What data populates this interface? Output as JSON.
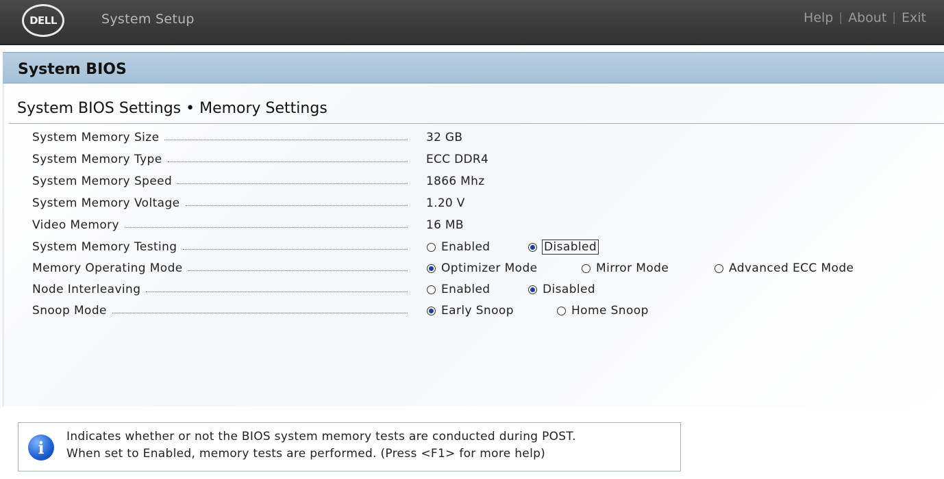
{
  "header": {
    "logo_text": "DELL",
    "app_title": "System Setup",
    "links": [
      "Help",
      "About",
      "Exit"
    ]
  },
  "section": {
    "title": "System BIOS"
  },
  "page": {
    "title": "System BIOS Settings • Memory Settings"
  },
  "settings": {
    "memory_size": {
      "label": "System Memory Size",
      "value": "32 GB"
    },
    "memory_type": {
      "label": "System Memory Type",
      "value": "ECC DDR4"
    },
    "memory_speed": {
      "label": "System Memory Speed",
      "value": "1866 Mhz"
    },
    "memory_voltage": {
      "label": "System Memory Voltage",
      "value": "1.20 V"
    },
    "video_memory": {
      "label": "Video Memory",
      "value": "16 MB"
    },
    "memory_testing": {
      "label": "System Memory Testing",
      "options": [
        "Enabled",
        "Disabled"
      ],
      "selected": "Disabled"
    },
    "operating_mode": {
      "label": "Memory Operating Mode",
      "options": [
        "Optimizer Mode",
        "Mirror Mode",
        "Advanced ECC Mode"
      ],
      "selected": "Optimizer Mode"
    },
    "node_interleaving": {
      "label": "Node Interleaving",
      "options": [
        "Enabled",
        "Disabled"
      ],
      "selected": "Disabled"
    },
    "snoop_mode": {
      "label": "Snoop Mode",
      "options": [
        "Early Snoop",
        "Home Snoop"
      ],
      "selected": "Early Snoop"
    }
  },
  "help": {
    "line1": "Indicates whether or not the BIOS system memory tests are conducted during POST.",
    "line2": "When set to Enabled, memory tests are performed. (Press <F1> for more help)"
  },
  "colors": {
    "header_bg": "#3a3a3a",
    "section_bar": "#afc7dd",
    "radio_selected": "#1a3f9c",
    "info_icon": "#1c5fd0"
  }
}
